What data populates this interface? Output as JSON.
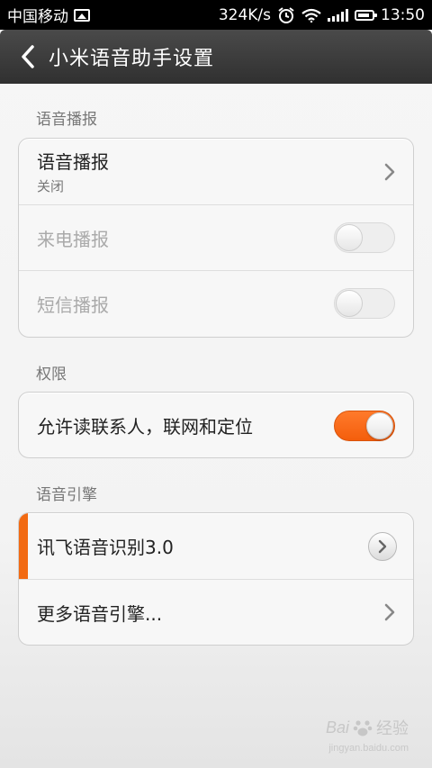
{
  "status_bar": {
    "carrier": "中国移动",
    "speed": "324K/s",
    "time": "13:50"
  },
  "header": {
    "title": "小米语音助手设置"
  },
  "sections": {
    "voice_broadcast": {
      "label": "语音播报",
      "items": [
        {
          "title": "语音播报",
          "subtitle": "关闭"
        },
        {
          "title": "来电播报",
          "toggle": "off"
        },
        {
          "title": "短信播报",
          "toggle": "off"
        }
      ]
    },
    "permissions": {
      "label": "权限",
      "items": [
        {
          "title": "允许读联系人，联网和定位",
          "toggle": "on"
        }
      ]
    },
    "engine": {
      "label": "语音引擎",
      "items": [
        {
          "title": "讯飞语音识别3.0"
        },
        {
          "title": "更多语音引擎..."
        }
      ]
    }
  },
  "watermark": {
    "brand": "Bai",
    "brand_cn": "经验",
    "url": "jingyan.baidu.com"
  },
  "colors": {
    "accent": "#f26a12",
    "title_bar": "#3c3c3c"
  }
}
